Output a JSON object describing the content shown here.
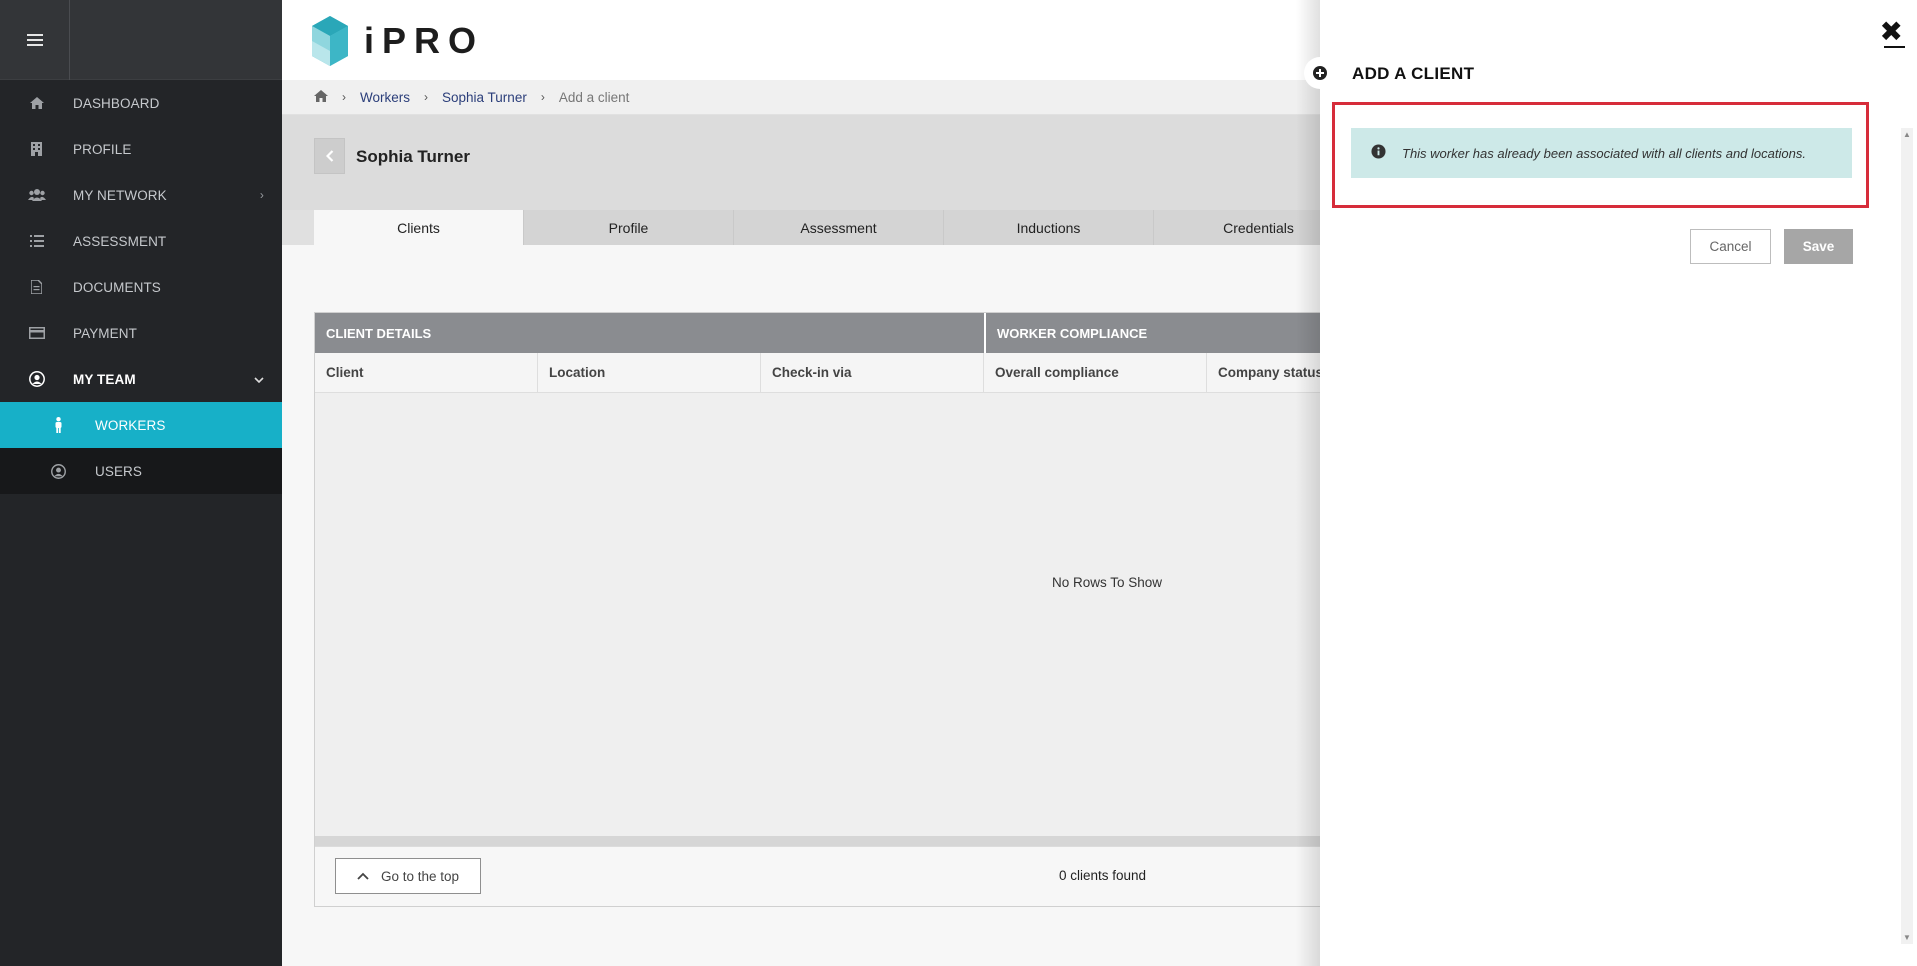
{
  "app": {
    "logo_text": "iPRO"
  },
  "sidebar": {
    "items": [
      {
        "label": "DASHBOARD",
        "icon": "home-icon"
      },
      {
        "label": "PROFILE",
        "icon": "building-icon"
      },
      {
        "label": "MY NETWORK",
        "icon": "users-icon"
      },
      {
        "label": "ASSESSMENT",
        "icon": "list-icon"
      },
      {
        "label": "DOCUMENTS",
        "icon": "document-icon"
      },
      {
        "label": "PAYMENT",
        "icon": "credit-card-icon"
      },
      {
        "label": "MY TEAM",
        "icon": "user-circle-icon"
      }
    ],
    "sub_items": [
      {
        "label": "WORKERS",
        "icon": "person-icon"
      },
      {
        "label": "USERS",
        "icon": "user-circle-icon"
      }
    ]
  },
  "breadcrumb": {
    "workers": "Workers",
    "worker": "Sophia Turner",
    "current": "Add a client"
  },
  "page": {
    "worker_name": "Sophia Turner",
    "tabs": [
      "Clients",
      "Profile",
      "Assessment",
      "Inductions",
      "Credentials"
    ]
  },
  "grid": {
    "groups": [
      "CLIENT DETAILS",
      "WORKER COMPLIANCE"
    ],
    "columns": [
      "Client",
      "Location",
      "Check-in via",
      "Overall compliance",
      "Company status"
    ],
    "empty_text": "No Rows To Show",
    "go_top": "Go to the top",
    "count": "0 clients found"
  },
  "drawer": {
    "title": "ADD A CLIENT",
    "alert": "This worker has already been associated with all clients and locations.",
    "cancel": "Cancel",
    "save": "Save"
  },
  "colors": {
    "accent": "#17b0c8",
    "sidebar": "#232528",
    "alert_bg": "#cde9e8",
    "highlight": "#d62c3a"
  }
}
